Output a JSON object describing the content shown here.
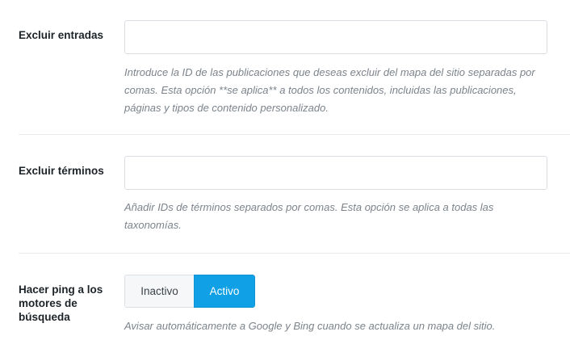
{
  "exclude_posts": {
    "label": "Excluir entradas",
    "value": "",
    "description": "Introduce la ID de las publicaciones que deseas excluir del mapa del sitio separadas por comas. Esta opción **se aplica** a todos los contenidos, incluidas las publicaciones, páginas y tipos de contenido personalizado."
  },
  "exclude_terms": {
    "label": "Excluir términos",
    "value": "",
    "description": "Añadir IDs de términos separados por comas. Esta opción se aplica a todas las taxonomías."
  },
  "ping_search_engines": {
    "label": "Hacer ping a los motores de búsqueda",
    "options": [
      "Inactivo",
      "Activo"
    ],
    "selected": "Activo",
    "description": "Avisar automáticamente a Google y Bing cuando se actualiza un mapa del sitio."
  },
  "colors": {
    "accent": "#10a0e6",
    "label": "#1e2327",
    "description": "#7c838b",
    "border": "#d9dde1",
    "divider": "#e9ebed"
  }
}
